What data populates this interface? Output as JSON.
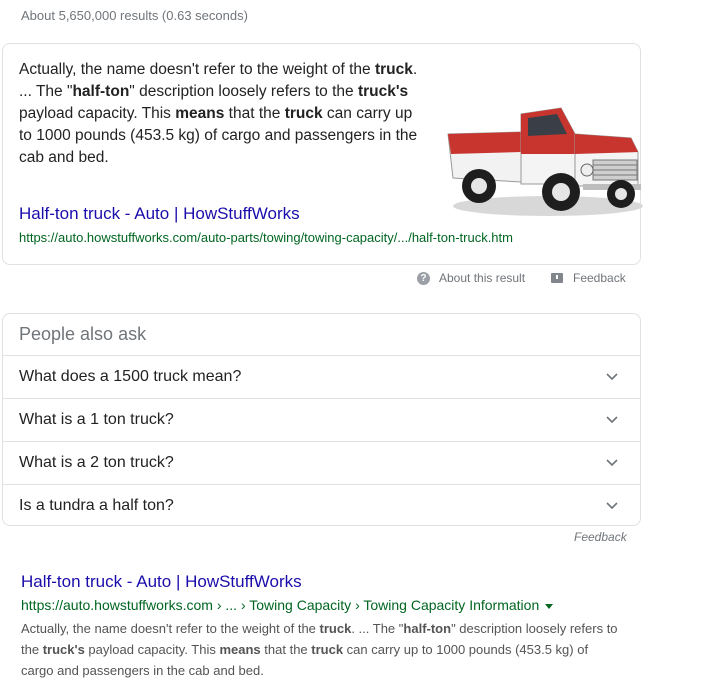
{
  "result_stats": "About 5,650,000 results (0.63 seconds)",
  "featured": {
    "text_parts": [
      "Actually, the name doesn't refer to the weight of the ",
      "truck",
      ". ... The \"",
      "half-ton",
      "\" description loosely refers to the ",
      "truck's",
      " payload capacity. This ",
      "means",
      " that the ",
      "truck",
      " can carry up to 1000 pounds (453.5 kg) of cargo and passengers in the cab and bed."
    ],
    "title": "Half-ton truck - Auto | HowStuffWorks",
    "url": "https://auto.howstuffworks.com/auto-parts/towing/towing-capacity/.../half-ton-truck.htm",
    "image_icon": "red-white-pickup-truck-photo"
  },
  "snippet_footer": {
    "about_label": "About this result",
    "feedback_label": "Feedback"
  },
  "people_also_ask": {
    "heading": "People also ask",
    "questions": [
      "What does a 1500 truck mean?",
      "What is a 1 ton truck?",
      "What is a 2 ton truck?",
      "Is a tundra a half ton?"
    ],
    "feedback_label": "Feedback"
  },
  "organic": {
    "title": "Half-ton truck - Auto | HowStuffWorks",
    "url": "https://auto.howstuffworks.com › ... › Towing Capacity › Towing Capacity Information",
    "snippet_parts": [
      "Actually, the name doesn't refer to the weight of the ",
      "truck",
      ". ... The \"",
      "half-ton",
      "\" description loosely refers to the ",
      "truck's",
      " payload capacity. This ",
      "means",
      " that the ",
      "truck",
      " can carry up to 1000 pounds (453.5 kg) of cargo and passengers in the cab and bed."
    ]
  },
  "colors": {
    "link": "#1a0dab",
    "url": "#006621",
    "muted": "#70757a",
    "border": "#dfe1e5"
  }
}
